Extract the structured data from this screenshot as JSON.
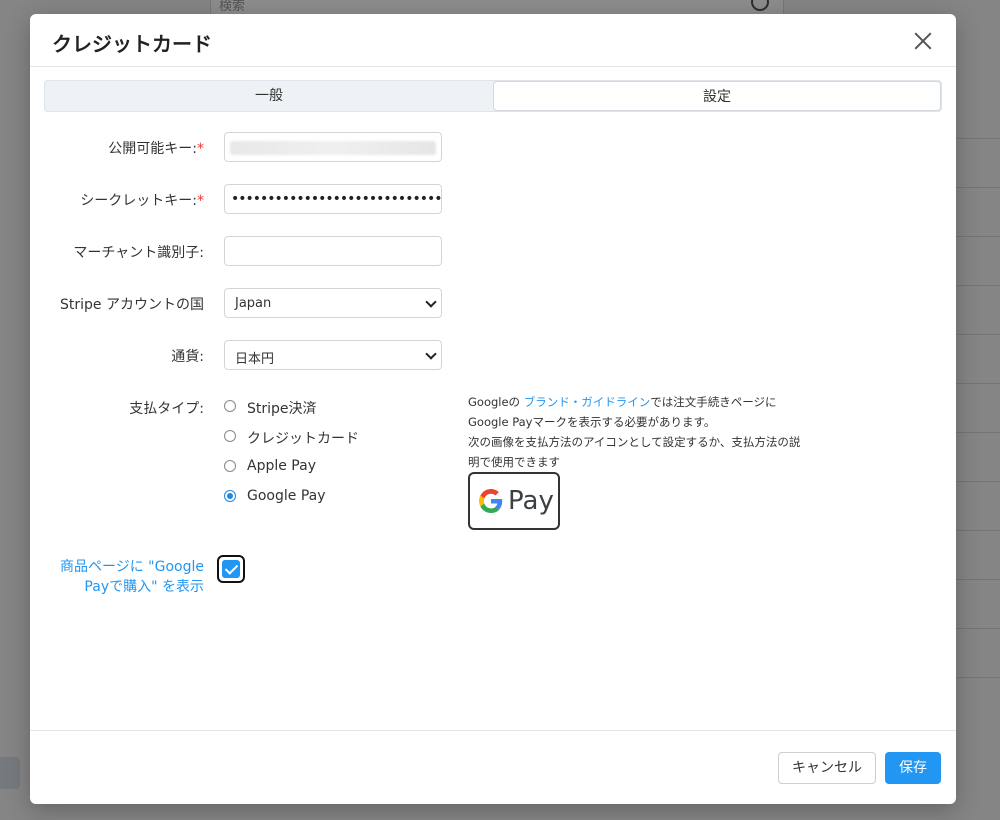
{
  "background": {
    "search_placeholder": "検索"
  },
  "modal": {
    "title": "クレジットカード",
    "tabs": [
      {
        "label": "一般",
        "active": false
      },
      {
        "label": "設定",
        "active": true
      }
    ],
    "fields": {
      "publishable_key": {
        "label": "公開可能キー:",
        "required_mark": "*",
        "value_visible": false
      },
      "secret_key": {
        "label": "シークレットキー:",
        "required_mark": "*",
        "value": "••••••••••••••••••••••••••••••••••••••••••"
      },
      "merchant_id": {
        "label": "マーチャント識別子:",
        "value": ""
      },
      "stripe_country": {
        "label": "Stripe アカウントの国",
        "selected": "Japan"
      },
      "currency": {
        "label": "通貨:",
        "selected": "日本円"
      }
    },
    "payment_type": {
      "label": "支払タイプ:",
      "options": [
        {
          "label": "Stripe決済",
          "checked": false
        },
        {
          "label": "クレジットカード",
          "checked": false
        },
        {
          "label": "Apple Pay",
          "checked": false
        },
        {
          "label": "Google Pay",
          "checked": true
        }
      ]
    },
    "gpay_note": {
      "prefix": "Googleの ",
      "link": "ブランド・ガイドライン",
      "suffix": "では注文手続きページに",
      "line2": "Google Payマークを表示する必要があります。",
      "line3": "次の画像を支払方法のアイコンとして設定するか、支払方法の説",
      "line4": "明で使用できます",
      "mark_text": "Pay"
    },
    "show_gpay_on_product": {
      "label_line1": "商品ページに \"Google",
      "label_line2": "Payで購入\" を表示",
      "checked": true
    },
    "buttons": {
      "cancel": "キャンセル",
      "save": "保存"
    },
    "colors": {
      "accent": "#2196f3",
      "required": "#e53935"
    }
  }
}
